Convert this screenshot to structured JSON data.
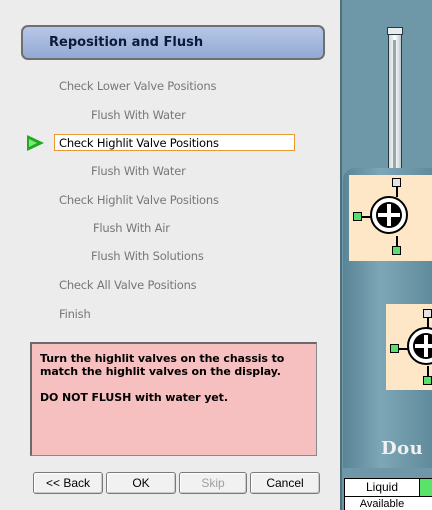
{
  "wizard": {
    "title": "Reposition and Flush",
    "steps": [
      {
        "label": "Check Lower Valve Positions"
      },
      {
        "label": "Flush With Water"
      },
      {
        "label": "Check Highlit Valve Positions",
        "current": true
      },
      {
        "label": "Flush With Water"
      },
      {
        "label": "Check Highlit Valve Positions"
      },
      {
        "label": "Flush With Air"
      },
      {
        "label": "Flush With Solutions"
      },
      {
        "label": "Check All Valve Positions"
      },
      {
        "label": "Finish"
      }
    ],
    "instructions": {
      "line1": "Turn the highlit valves on the chassis to match the highlit valves on the display.",
      "line2": "DO NOT FLUSH with water yet."
    },
    "buttons": {
      "back": "<< Back",
      "ok": "OK",
      "skip": "Skip",
      "cancel": "Cancel"
    }
  },
  "diagram": {
    "label": "Dou",
    "legend": {
      "liquid": "Liquid",
      "available": "Available"
    },
    "colors": {
      "background": "#6e98a8",
      "valve_highlight": "#fde7c6",
      "port_green": "#58e06a"
    }
  }
}
